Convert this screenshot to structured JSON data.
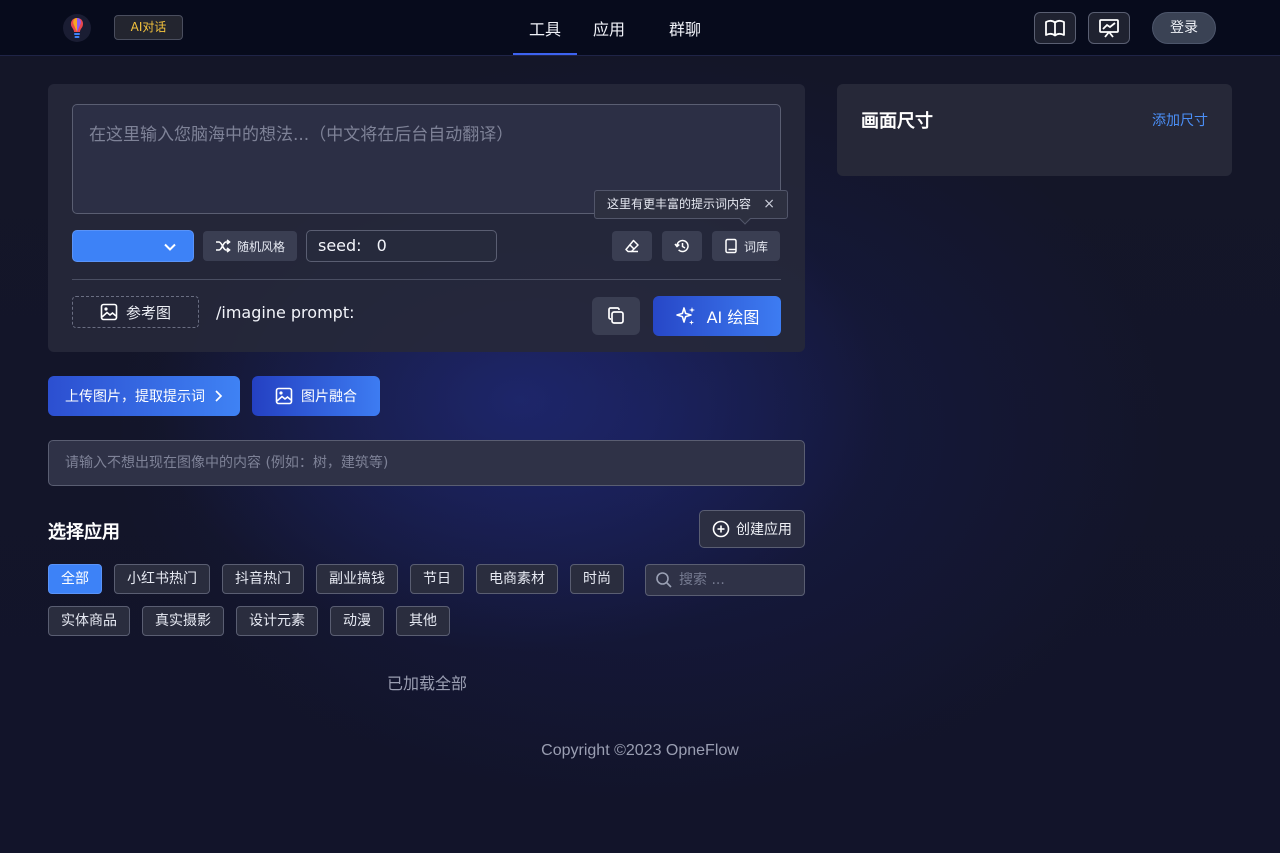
{
  "header": {
    "ai_chat_label": "AI对话",
    "nav": [
      "工具",
      "应用",
      "群聊"
    ],
    "active_nav": "工具",
    "login_label": "登录"
  },
  "editor": {
    "prompt_placeholder": "在这里输入您脑海中的想法...（中文将在后台自动翻译）",
    "style_select_value": "",
    "random_style_label": "随机风格",
    "seed_label": "seed:",
    "seed_value": "0",
    "tooltip_text": "这里有更丰富的提示词内容",
    "tooltip_close": "×",
    "lexicon_label": "词库",
    "reference_label": "参考图",
    "imagine_label": "/imagine prompt:",
    "draw_label": "AI 绘图"
  },
  "actions": {
    "upload_label": "上传图片，提取提示词",
    "fuse_label": "图片融合"
  },
  "negative": {
    "placeholder": "请输入不想出现在图像中的内容 (例如：树，建筑等)"
  },
  "apps": {
    "title": "选择应用",
    "create_label": "创建应用",
    "tags_row1": [
      "全部",
      "小红书热门",
      "抖音热门",
      "副业搞钱",
      "节日",
      "电商素材",
      "时尚"
    ],
    "tags_row2": [
      "实体商品",
      "真实摄影",
      "设计元素",
      "动漫",
      "其他"
    ],
    "active_tag": "全部",
    "search_placeholder": "搜索 ...",
    "loaded_text": "已加载全部"
  },
  "footer": {
    "copyright": "Copyright ©2023 OpneFlow"
  },
  "size_panel": {
    "title": "画面尺寸",
    "add_label": "添加尺寸"
  },
  "colors": {
    "accent": "#3d82f7",
    "link": "#4b8ff7",
    "ai_chat_text": "#f4c33d"
  }
}
